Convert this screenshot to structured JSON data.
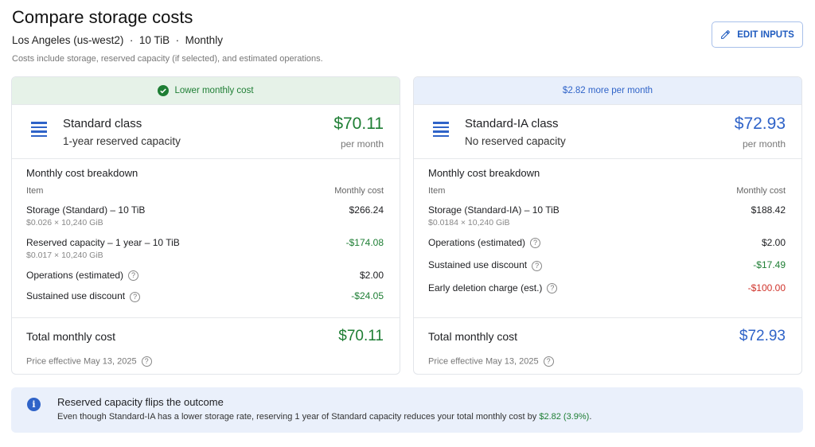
{
  "header": {
    "title": "Compare storage costs",
    "location": "Los Angeles (us-west2)",
    "size": "10 TiB",
    "period": "Monthly",
    "separator": "·",
    "note": "Costs include storage, reserved capacity (if selected), and estimated operations.",
    "edit_label": "EDIT INPUTS"
  },
  "colors": {
    "green": "#1e7e34",
    "blue": "#2f63c8",
    "red": "#d0342c"
  },
  "left": {
    "banner": "Lower monthly cost",
    "name": "Standard class",
    "desc": "1-year reserved capacity",
    "price": "$70.11",
    "per": "per month",
    "breakdown_title": "Monthly cost breakdown",
    "col_item": "Item",
    "col_cost": "Monthly cost",
    "rows": [
      {
        "label": "Storage (Standard) – 10 TiB",
        "detail": "$0.026 × 10,240 GiB",
        "value": "$266.24"
      },
      {
        "label": "Reserved capacity – 1 year – 10 TiB",
        "detail": "$0.017 × 10,240 GiB",
        "value": "-$174.08"
      },
      {
        "label": "Operations (estimated)",
        "value": "$2.00"
      },
      {
        "label": "Sustained use discount",
        "value": "-$24.05"
      }
    ],
    "total_label": "Total monthly cost",
    "total": "$70.11",
    "effective": "Price effective May 13, 2025"
  },
  "right": {
    "banner": "$2.82 more per month",
    "name": "Standard-IA class",
    "desc": "No reserved capacity",
    "price": "$72.93",
    "per": "per month",
    "breakdown_title": "Monthly cost breakdown",
    "col_item": "Item",
    "col_cost": "Monthly cost",
    "rows": [
      {
        "label": "Storage (Standard-IA) – 10 TiB",
        "detail": "$0.0184 × 10,240 GiB",
        "value": "$188.42"
      },
      {
        "label": "Operations (estimated)",
        "value": "$2.00"
      },
      {
        "label": "Sustained use discount",
        "value": "-$17.49"
      },
      {
        "label": "Early deletion charge (est.)",
        "value": "-$100.00"
      }
    ],
    "total_label": "Total monthly cost",
    "total": "$72.93",
    "effective": "Price effective May 13, 2025"
  },
  "info": {
    "title": "Reserved capacity flips the outcome",
    "body": "Even though Standard-IA has a lower storage rate, reserving 1 year of Standard capacity reduces your total monthly cost by ",
    "highlight": "$2.82 (3.9%)",
    "end": "."
  }
}
